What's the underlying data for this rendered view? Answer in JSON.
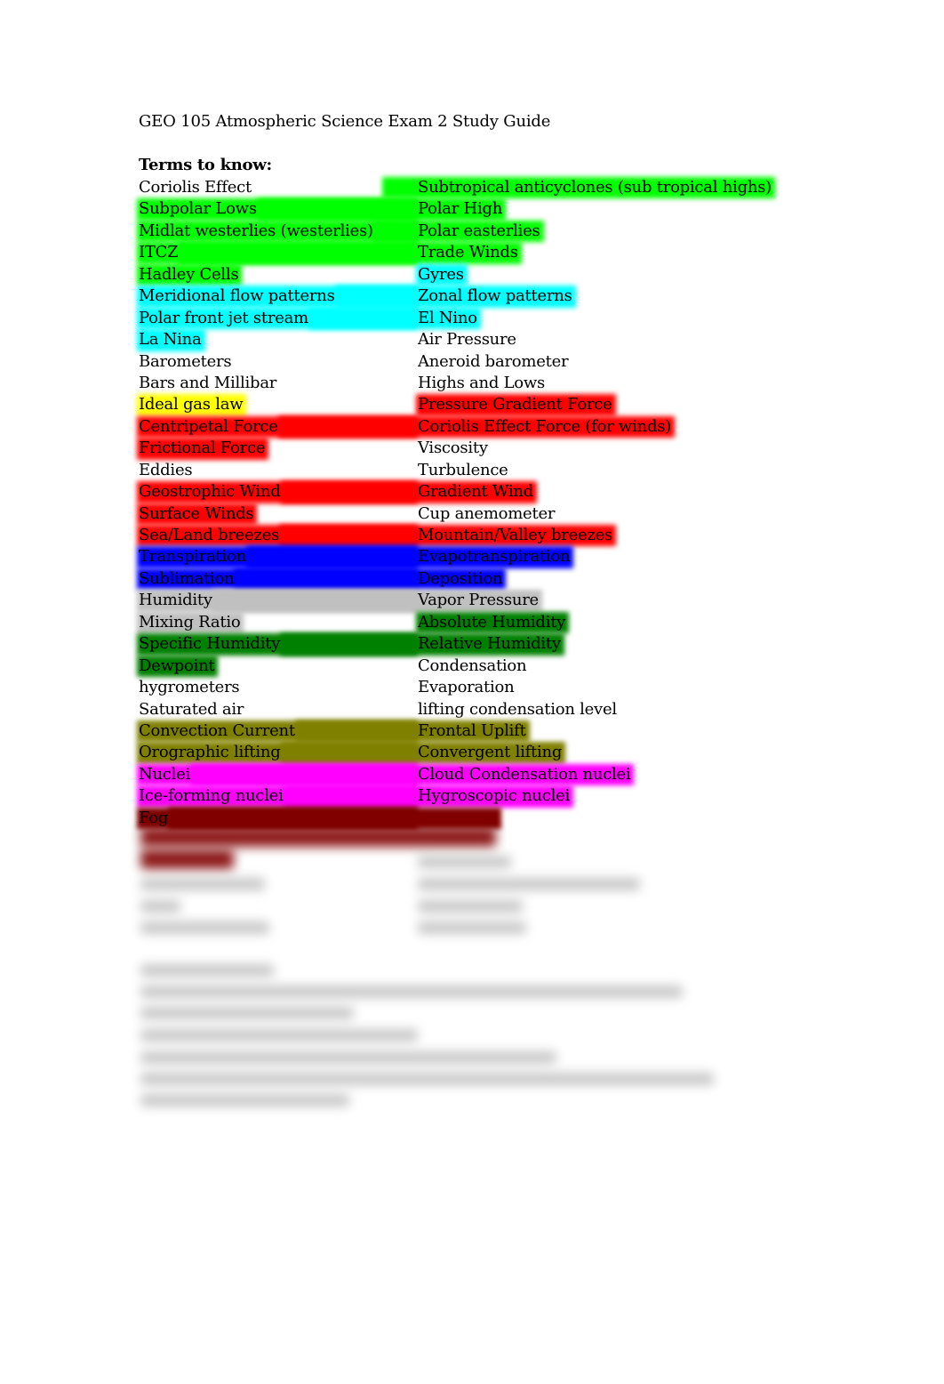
{
  "document": {
    "title": "GEO 105 Atmospheric Science Exam 2 Study Guide",
    "terms_heading": "Terms to know:",
    "highlight_colors": {
      "green": "#00ff00",
      "cyan": "#00ffff",
      "yellow": "#ffff00",
      "red": "#ff0000",
      "blue": "#0000ff",
      "gray": "#c0c0c0",
      "darkgreen": "#008000",
      "olive": "#808000",
      "magenta": "#ff00ff",
      "darkred": "#800000"
    },
    "terms": [
      {
        "left": "Coriolis Effect",
        "left_hl": "",
        "right": "Subtropical anticyclones (sub tropical highs)",
        "right_hl": "green"
      },
      {
        "left": "Subpolar Lows",
        "left_hl": "green",
        "right": "Polar High",
        "right_hl": "green"
      },
      {
        "left": "Midlat westerlies (westerlies)",
        "left_hl": "green",
        "right": "Polar easterlies",
        "right_hl": "green"
      },
      {
        "left": "ITCZ",
        "left_hl": "green",
        "right": "Trade Winds",
        "right_hl": "green"
      },
      {
        "left": "Hadley Cells",
        "left_hl": "green",
        "right": "Gyres",
        "right_hl": "cyan"
      },
      {
        "left": "Meridional flow patterns",
        "left_hl": "cyan",
        "right": "Zonal flow patterns",
        "right_hl": "cyan"
      },
      {
        "left": "Polar front jet stream",
        "left_hl": "cyan",
        "right": "El Nino",
        "right_hl": "cyan"
      },
      {
        "left": "La Nina",
        "left_hl": "cyan",
        "right": "Air Pressure",
        "right_hl": ""
      },
      {
        "left": "Barometers",
        "left_hl": "",
        "right": "Aneroid barometer",
        "right_hl": ""
      },
      {
        "left": "Bars and Millibar",
        "left_hl": "",
        "right": "Highs and Lows",
        "right_hl": ""
      },
      {
        "left": "Ideal gas law",
        "left_hl": "yellow",
        "right": "Pressure Gradient Force",
        "right_hl": "red"
      },
      {
        "left": "Centripetal Force",
        "left_hl": "red",
        "right": "Coriolis Effect Force (for winds)",
        "right_hl": "red"
      },
      {
        "left": "Frictional Force",
        "left_hl": "red",
        "right": "Viscosity",
        "right_hl": ""
      },
      {
        "left": "Eddies",
        "left_hl": "",
        "right": "Turbulence",
        "right_hl": ""
      },
      {
        "left": "Geostrophic Wind",
        "left_hl": "red",
        "right": "Gradient Wind",
        "right_hl": "red"
      },
      {
        "left": "Surface Winds",
        "left_hl": "red",
        "right": "Cup anemometer",
        "right_hl": ""
      },
      {
        "left": "Sea/Land breezes",
        "left_hl": "red",
        "right": "Mountain/Valley breezes",
        "right_hl": "red"
      },
      {
        "left": "Transpiration",
        "left_hl": "blue",
        "right": "Evapotranspiration",
        "right_hl": "blue"
      },
      {
        "left": "Sublimation",
        "left_hl": "blue",
        "right": "Deposition",
        "right_hl": "blue"
      },
      {
        "left": "Humidity",
        "left_hl": "gray",
        "right": "Vapor Pressure",
        "right_hl": "gray"
      },
      {
        "left": "Mixing Ratio",
        "left_hl": "gray",
        "right": "Absolute Humidity",
        "right_hl": "darkgreen"
      },
      {
        "left": "Specific Humidity",
        "left_hl": "darkgreen",
        "right": "Relative Humidity",
        "right_hl": "darkgreen"
      },
      {
        "left": "Dewpoint",
        "left_hl": "darkgreen",
        "right": "Condensation",
        "right_hl": ""
      },
      {
        "left": "hygrometers",
        "left_hl": "",
        "right": "Evaporation",
        "right_hl": ""
      },
      {
        "left": "Saturated air",
        "left_hl": "",
        "right": "lifting condensation level",
        "right_hl": ""
      },
      {
        "left": "Convection Current",
        "left_hl": "olive",
        "right": "Frontal Uplift",
        "right_hl": "olive"
      },
      {
        "left": "Orographic lifting",
        "left_hl": "olive",
        "right": "Convergent lifting",
        "right_hl": "olive"
      },
      {
        "left": "Nuclei",
        "left_hl": "magenta",
        "right": "Cloud Condensation nuclei",
        "right_hl": "magenta"
      },
      {
        "left": "Ice-forming nuclei",
        "left_hl": "magenta",
        "right": "Hygroscopic nuclei",
        "right_hl": "magenta"
      },
      {
        "left": "Fog",
        "left_hl": "darkred",
        "right": "",
        "right_hl": "darkred"
      }
    ]
  }
}
